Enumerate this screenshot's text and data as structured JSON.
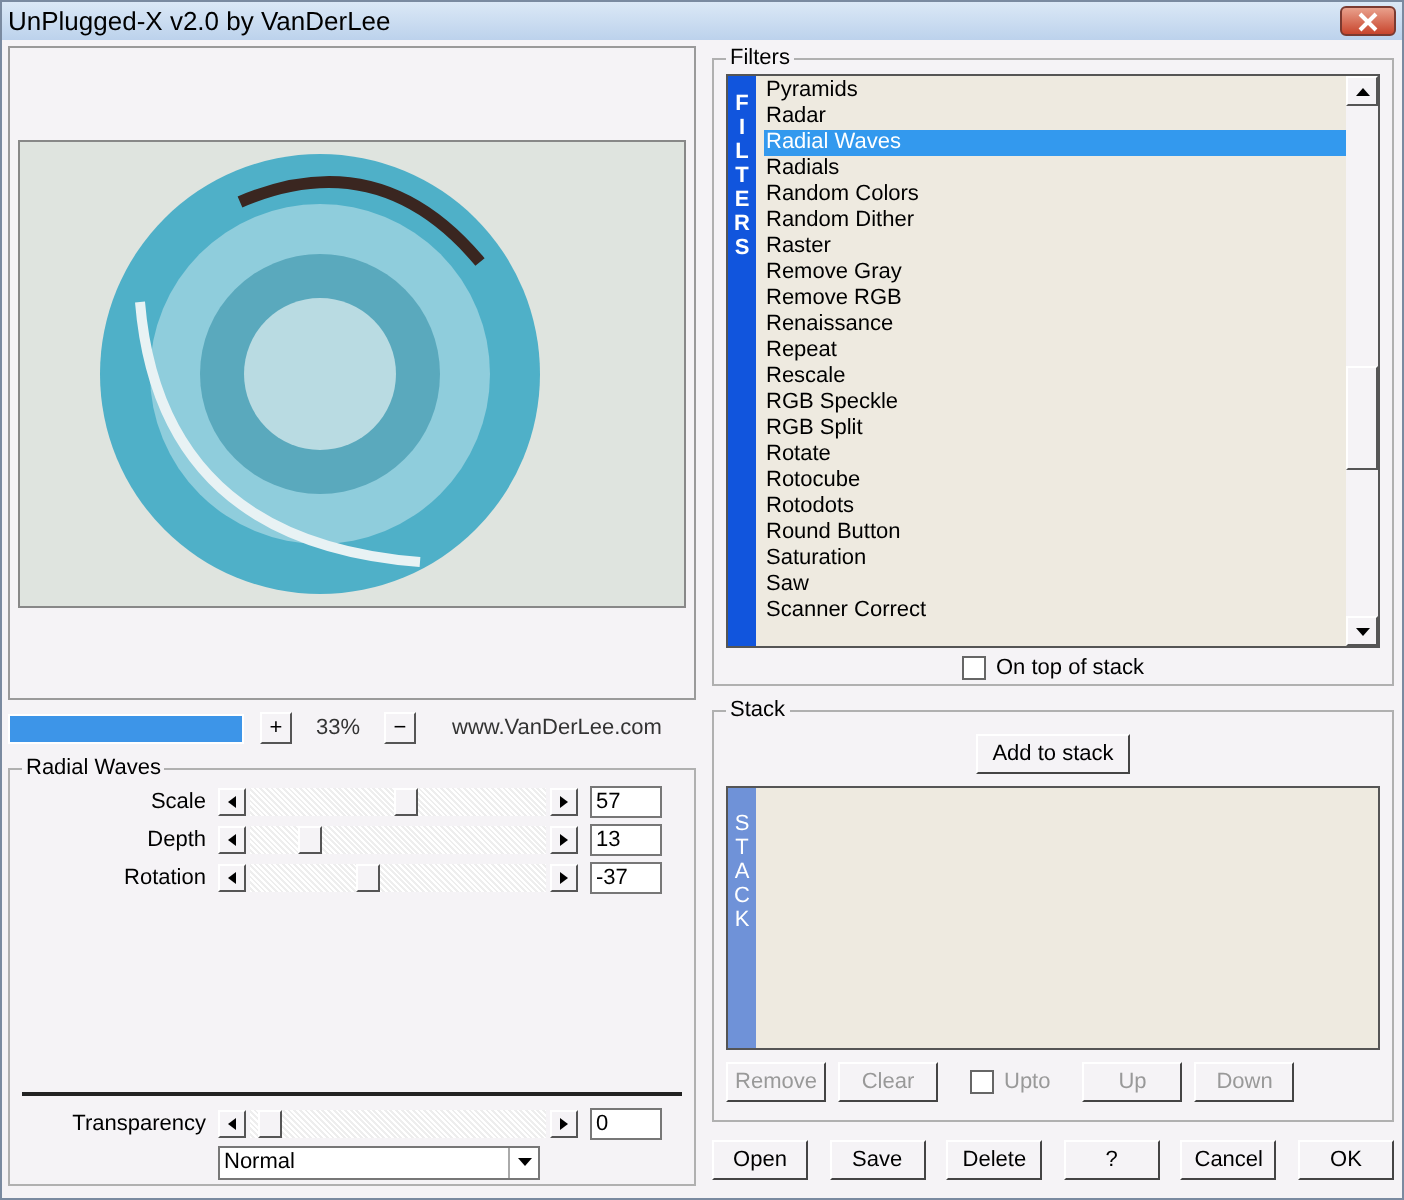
{
  "window": {
    "title": "UnPlugged-X v2.0 by VanDerLee"
  },
  "preview": {
    "progress": {
      "level": 1
    },
    "zoom_in": "+",
    "zoom": "33%",
    "zoom_out": "−",
    "website": "www.VanDerLee.com"
  },
  "parameters": {
    "title": "Radial Waves",
    "sliders": [
      {
        "label": "Scale",
        "level": 0.53,
        "value": "57"
      },
      {
        "label": "Depth",
        "level": 0.18,
        "value": "13"
      },
      {
        "label": "Rotation",
        "level": 0.39,
        "value": "-37"
      }
    ],
    "transparency": {
      "label": "Transparency",
      "level": 0.03,
      "value": "0"
    },
    "blend_mode": "Normal"
  },
  "filters": {
    "title": "Filters",
    "strip": "FILTERS",
    "items": [
      {
        "label": "Pyramids",
        "selected": false
      },
      {
        "label": "Radar",
        "selected": false
      },
      {
        "label": "Radial Waves",
        "selected": true
      },
      {
        "label": "Radials",
        "selected": false
      },
      {
        "label": "Random Colors",
        "selected": false
      },
      {
        "label": "Random Dither",
        "selected": false
      },
      {
        "label": "Raster",
        "selected": false
      },
      {
        "label": "Remove Gray",
        "selected": false
      },
      {
        "label": "Remove RGB",
        "selected": false
      },
      {
        "label": "Renaissance",
        "selected": false
      },
      {
        "label": "Repeat",
        "selected": false
      },
      {
        "label": "Rescale",
        "selected": false
      },
      {
        "label": "RGB Speckle",
        "selected": false
      },
      {
        "label": "RGB Split",
        "selected": false
      },
      {
        "label": "Rotate",
        "selected": false
      },
      {
        "label": "Rotocube",
        "selected": false
      },
      {
        "label": "Rotodots",
        "selected": false
      },
      {
        "label": "Round Button",
        "selected": false
      },
      {
        "label": "Saturation",
        "selected": false
      },
      {
        "label": "Saw",
        "selected": false
      },
      {
        "label": "Scanner Correct",
        "selected": false
      }
    ],
    "on_top": {
      "label": "On top of stack",
      "checked": false
    }
  },
  "stack": {
    "title": "Stack",
    "add": "Add to stack",
    "strip": "STACK",
    "buttons": [
      {
        "label": "Remove",
        "disabled": true
      },
      {
        "label": "Clear",
        "disabled": true
      }
    ],
    "upto": {
      "label": "Upto",
      "checked": false,
      "disabled": true
    },
    "buttons_right": [
      {
        "label": "Up",
        "disabled": true
      },
      {
        "label": "Down",
        "disabled": true
      }
    ]
  },
  "buttons": [
    "Open",
    "Save",
    "Delete",
    "?",
    "Cancel",
    "OK"
  ]
}
